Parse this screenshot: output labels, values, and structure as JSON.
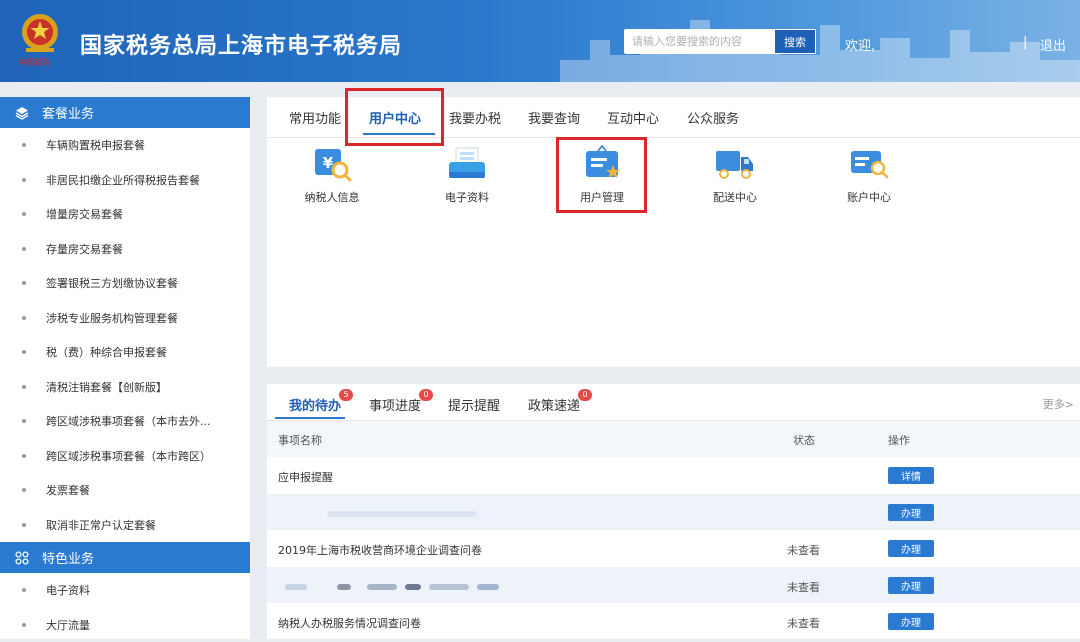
{
  "header": {
    "title": "国家税务总局上海市电子税务局",
    "search_placeholder": "请输入您要搜索的内容",
    "search_button": "搜索",
    "welcome": "欢迎,",
    "divider": "|",
    "logout": "退出"
  },
  "sidebar": {
    "sections": [
      {
        "title": "套餐业务",
        "icon": "layers-icon",
        "items": [
          "车辆购置税申报套餐",
          "非居民扣缴企业所得税报告套餐",
          "增量房交易套餐",
          "存量房交易套餐",
          "签署银税三方划缴协议套餐",
          "涉税专业服务机构管理套餐",
          "税（费）种综合申报套餐",
          "清税注销套餐【创新版】",
          "跨区域涉税事项套餐（本市去外...",
          "跨区域涉税事项套餐（本市跨区）",
          "发票套餐",
          "取消非正常户认定套餐"
        ]
      },
      {
        "title": "特色业务",
        "icon": "grid-icon",
        "items": [
          "电子资料",
          "大厅流量"
        ]
      }
    ]
  },
  "main_tabs": [
    "常用功能",
    "用户中心",
    "我要办税",
    "我要查询",
    "互动中心",
    "公众服务"
  ],
  "active_tab": "用户中心",
  "functions": [
    {
      "label": "纳税人信息",
      "icon": "taxpayer-info-icon"
    },
    {
      "label": "电子资料",
      "icon": "electronic-docs-icon"
    },
    {
      "label": "用户管理",
      "icon": "user-management-icon"
    },
    {
      "label": "配送中心",
      "icon": "delivery-truck-icon"
    },
    {
      "label": "账户中心",
      "icon": "account-center-icon"
    }
  ],
  "todo": {
    "tabs": [
      {
        "label": "我的待办",
        "badge": "5"
      },
      {
        "label": "事项进度",
        "badge": "0"
      },
      {
        "label": "提示提醒",
        "badge": ""
      },
      {
        "label": "政策速递",
        "badge": "0"
      }
    ],
    "more": "更多>",
    "columns": [
      "事项名称",
      "状态",
      "操作"
    ],
    "rows": [
      {
        "name": "应申报提醒",
        "status": "",
        "action": "详情"
      },
      {
        "name": "",
        "status": "",
        "action": "办理"
      },
      {
        "name": "2019年上海市税收营商环境企业调查问卷",
        "status": "未查看",
        "action": "办理"
      },
      {
        "name": "",
        "status": "未查看",
        "action": "办理"
      },
      {
        "name": "纳税人办税服务情况调查问卷",
        "status": "未查看",
        "action": "办理"
      }
    ]
  },
  "colors": {
    "primary": "#2a7ad1",
    "header": "#1f64b8",
    "highlight": "#d8282a",
    "badge": "#e84a4a"
  }
}
